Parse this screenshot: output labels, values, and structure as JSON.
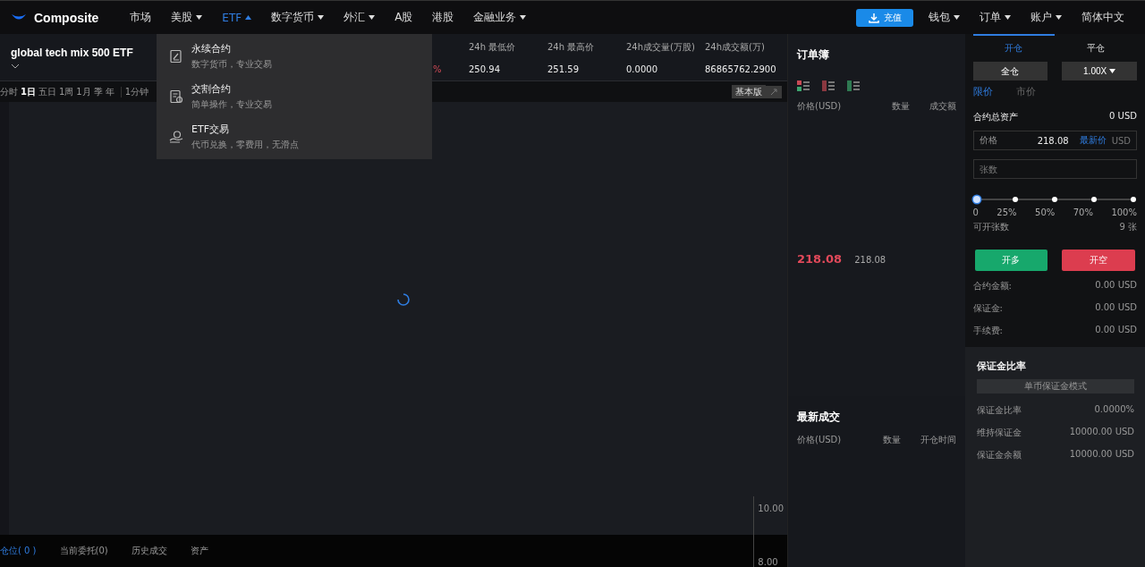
{
  "nav": {
    "brand": "Composite",
    "items": [
      {
        "label": "市场",
        "dropdown": false,
        "selected": false
      },
      {
        "label": "美股",
        "dropdown": true,
        "expanded": false,
        "selected": false
      },
      {
        "label": "ETF",
        "dropdown": true,
        "expanded": true,
        "selected": true
      },
      {
        "label": "数字货币",
        "dropdown": true,
        "expanded": false,
        "selected": false
      },
      {
        "label": "外汇",
        "dropdown": true,
        "expanded": false,
        "selected": false
      },
      {
        "label": "A股",
        "dropdown": false,
        "selected": false
      },
      {
        "label": "港股",
        "dropdown": false,
        "selected": false
      },
      {
        "label": "金融业务",
        "dropdown": true,
        "expanded": false,
        "selected": false
      }
    ],
    "deposit": "充值",
    "right": [
      {
        "label": "钱包",
        "dropdown": true
      },
      {
        "label": "订单",
        "dropdown": true
      },
      {
        "label": "账户",
        "dropdown": true
      },
      {
        "label": "简体中文",
        "dropdown": false
      }
    ]
  },
  "menu": [
    {
      "kind": "perpetual",
      "title": "永续合约",
      "subtitle": "数字货币，专业交易"
    },
    {
      "kind": "delivery",
      "title": "交割合约",
      "subtitle": "简单操作，专业交易"
    },
    {
      "kind": "etf",
      "title": "ETF交易",
      "subtitle": "代币兑换，零费用，无滑点"
    }
  ],
  "symbol": {
    "name": "global tech mix 500 ETF",
    "change": "%",
    "stats": [
      {
        "label": "24h 最低价",
        "value": "250.94"
      },
      {
        "label": "24h 最高价",
        "value": "251.59"
      },
      {
        "label": "24h成交量(万股)",
        "value": "0.0000"
      },
      {
        "label": "24h成交额(万)",
        "value": "86865762.2900"
      }
    ]
  },
  "toolbar": {
    "periods": [
      {
        "label": "分时",
        "selected": false
      },
      {
        "label": "1日",
        "selected": true
      },
      {
        "label": "五日",
        "selected": false
      },
      {
        "label": "1周",
        "selected": false
      },
      {
        "label": "1月",
        "selected": false
      },
      {
        "label": "季",
        "selected": false
      },
      {
        "label": "年",
        "selected": false
      }
    ],
    "interval": "1分钟",
    "mode": "基本版"
  },
  "chart": {
    "axis_labels": [
      "10.00",
      "8.00"
    ]
  },
  "bottom_tabs": [
    {
      "label": "仓位( 0 )",
      "selected": true
    },
    {
      "label": "当前委托(0)",
      "selected": false
    },
    {
      "label": "历史成交",
      "selected": false
    },
    {
      "label": "资产",
      "selected": false
    }
  ],
  "orderbook": {
    "title": "订单簿",
    "columns": [
      "价格(USD)",
      "数量",
      "成交额"
    ],
    "last_price": "218.08",
    "last_price_sub": "218.08"
  },
  "trades": {
    "title": "最新成交",
    "columns": [
      "价格(USD)",
      "数量",
      "开仓时间"
    ]
  },
  "trade_panel": {
    "tabs": [
      {
        "label": "开仓",
        "selected": true
      },
      {
        "label": "平仓",
        "selected": false
      }
    ],
    "margin_mode": "全仓",
    "leverage": "1.00X",
    "order_types": [
      {
        "label": "限价",
        "selected": true
      },
      {
        "label": "市价",
        "selected": false
      }
    ],
    "total_assets_label": "合约总资产",
    "total_assets": "0 USD",
    "price_field": {
      "label": "价格",
      "value": "218.08",
      "link": "最新价",
      "unit": "USD"
    },
    "qty_field": {
      "placeholder": "张数"
    },
    "slider": {
      "level": 0,
      "marks": [
        "0",
        "25%",
        "50%",
        "70%",
        "100%"
      ]
    },
    "available_label": "可开张数",
    "available": "9 张",
    "buy": "开多",
    "sell": "开空",
    "summary": [
      {
        "label": "合约金额:",
        "value": "0.00 USD"
      },
      {
        "label": "保证金:",
        "value": "0.00 USD"
      },
      {
        "label": "手续费:",
        "value": "0.00 USD"
      }
    ]
  },
  "margin": {
    "title": "保证金比率",
    "mode": "单币保证金模式",
    "rows": [
      {
        "label": "保证金比率",
        "value": "0.0000%"
      },
      {
        "label": "维持保证金",
        "value": "10000.00 USD"
      },
      {
        "label": "保证金余额",
        "value": "10000.00 USD"
      }
    ]
  }
}
